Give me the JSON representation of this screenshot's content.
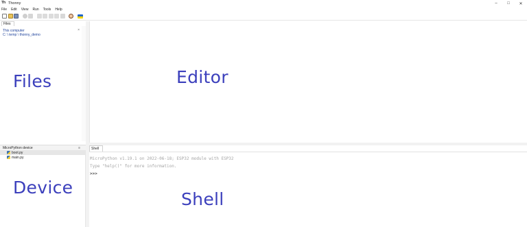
{
  "window": {
    "title": "Thonny",
    "controls": {
      "minimize": "–",
      "maximize": "□",
      "close": "✕"
    }
  },
  "menu": {
    "items": [
      "File",
      "Edit",
      "View",
      "Run",
      "Tools",
      "Help"
    ]
  },
  "toolbar": {
    "buttons": [
      {
        "name": "new-file-icon"
      },
      {
        "name": "open-file-icon"
      },
      {
        "name": "save-file-icon"
      },
      {
        "name": "run-icon"
      },
      {
        "name": "debug-icon"
      },
      {
        "name": "step-over-icon"
      },
      {
        "name": "step-into-icon"
      },
      {
        "name": "step-out-icon"
      },
      {
        "name": "resume-icon"
      },
      {
        "name": "stop-icon"
      },
      {
        "name": "support-icon"
      },
      {
        "name": "ukraine-flag-icon"
      }
    ]
  },
  "files": {
    "tab_label": "Files",
    "tab_close": "×",
    "computer_heading": "This computer",
    "computer_path": "C: \\ temp \\ thonny_demo",
    "close_glyph": "×"
  },
  "device": {
    "heading": "MicroPython device",
    "close_glyph": "≡",
    "files": [
      "boot.py",
      "main.py"
    ]
  },
  "shell": {
    "tab_label": "Shell",
    "tab_close": "×",
    "lines": [
      "MicroPython v1.19.1 on 2022-06-18; ESP32 module with ESP32",
      "Type \"help()\" for more information.",
      ">>>"
    ]
  },
  "annotations": {
    "files": "Files",
    "editor": "Editor",
    "device": "Device",
    "shell": "Shell"
  },
  "colors": {
    "annotation": "#3b3fbc",
    "path_text": "#1a3f9a"
  }
}
